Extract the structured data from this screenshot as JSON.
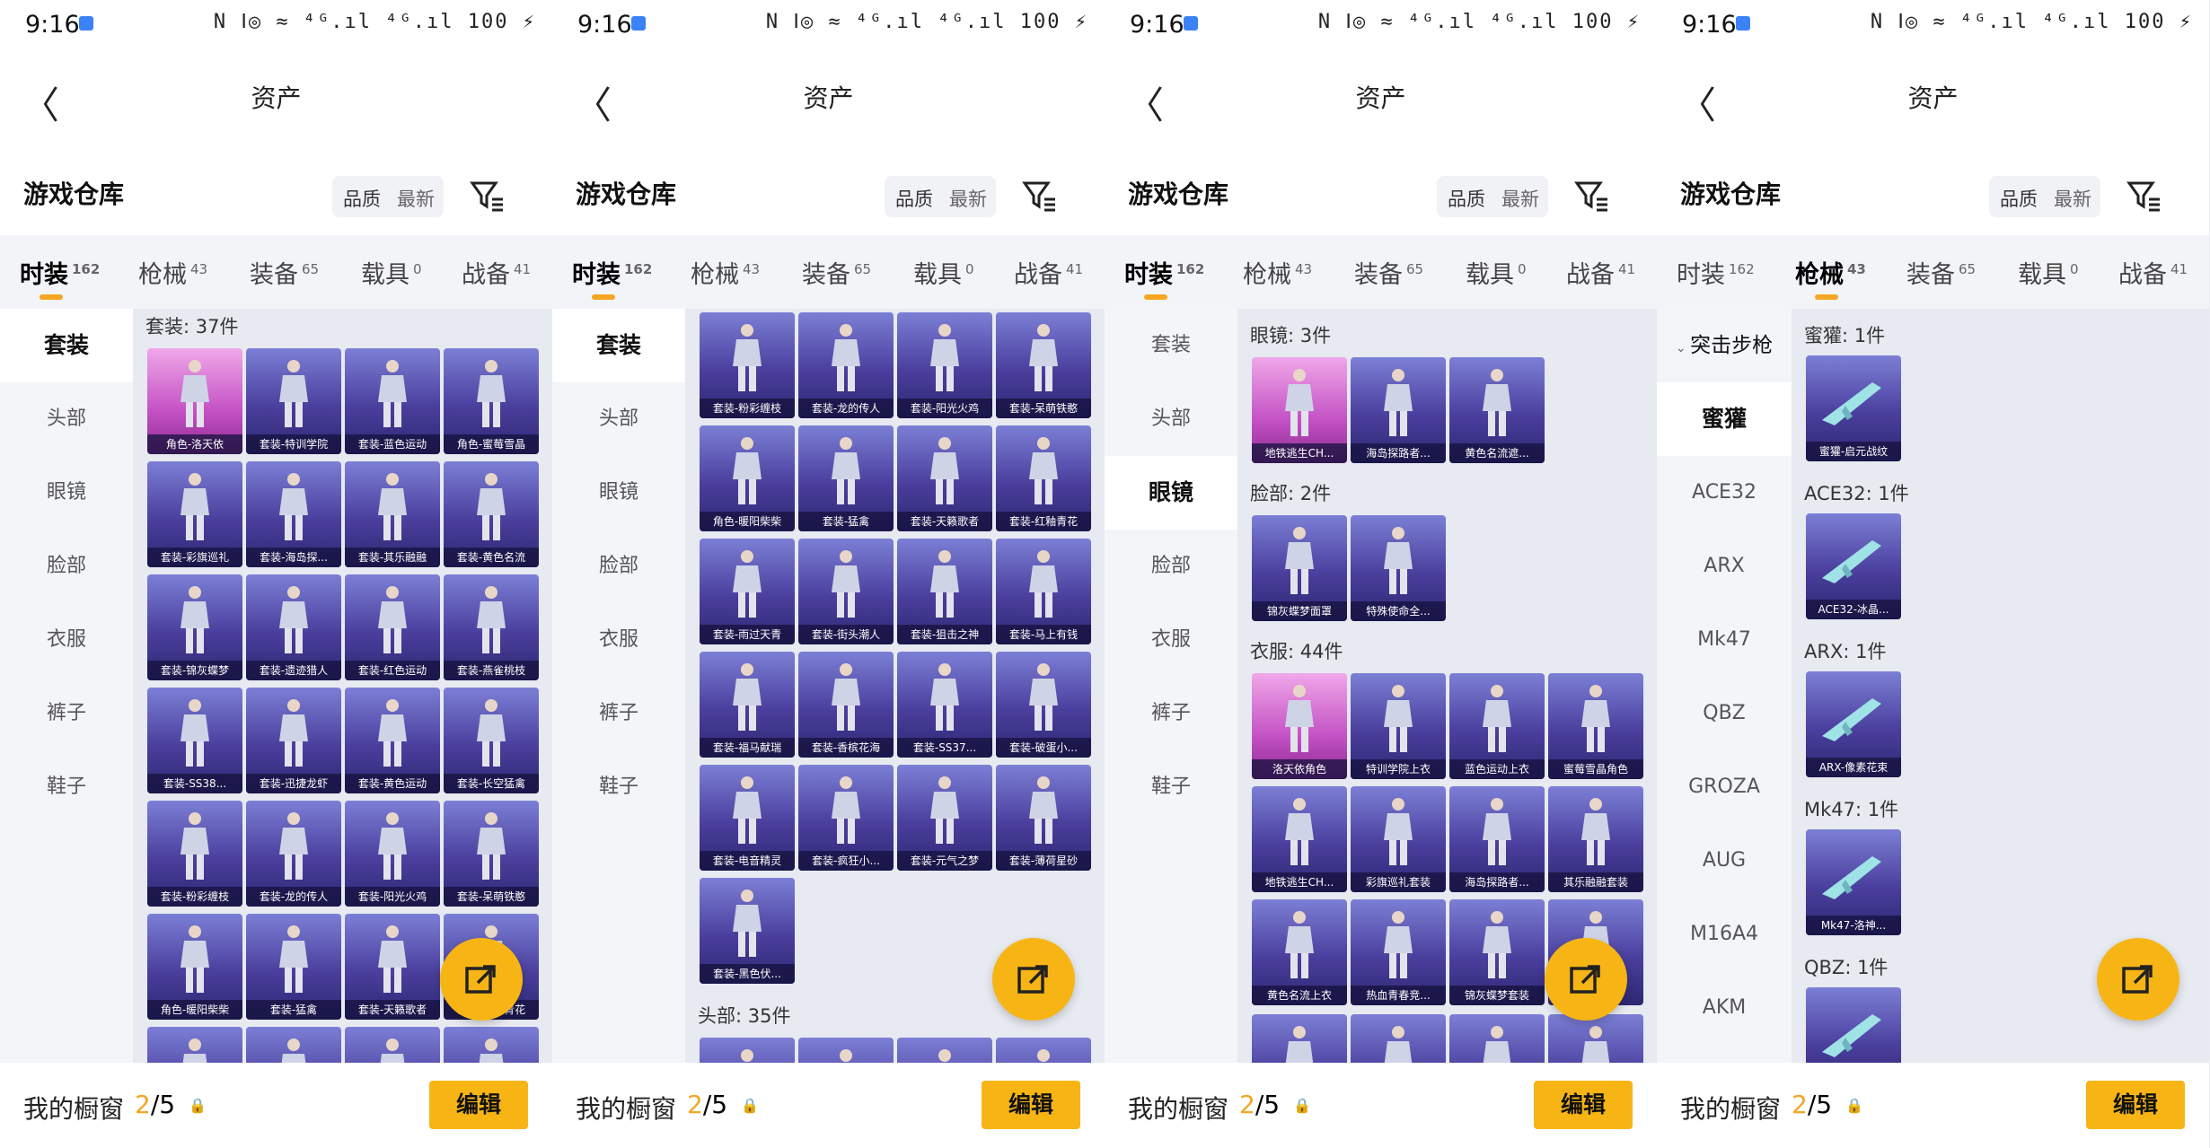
{
  "status": {
    "time": "9:16",
    "icons": "N Ⅰ◎ ≈ ⁴ᴳ.ıl ⁴ᴳ.ıl 100 ⚡"
  },
  "nav": {
    "back": "〈",
    "title": "资产"
  },
  "warehouse": {
    "title": "游戏仓库",
    "sort_quality": "品质",
    "sort_newest": "最新"
  },
  "tabs": [
    {
      "label": "时装",
      "count": "162"
    },
    {
      "label": "枪械",
      "count": "43"
    },
    {
      "label": "装备",
      "count": "65"
    },
    {
      "label": "载具",
      "count": "0"
    },
    {
      "label": "战备",
      "count": "41"
    }
  ],
  "fashion_side": [
    "套装",
    "头部",
    "眼镜",
    "脸部",
    "衣服",
    "裤子",
    "鞋子"
  ],
  "gun_side": [
    "突击步枪",
    "蜜獾",
    "ACE32",
    "ARX",
    "Mk47",
    "QBZ",
    "GROZA",
    "AUG",
    "M16A4",
    "AKM"
  ],
  "bottom": {
    "label": "我的橱窗",
    "count_a": "2",
    "count_b": "/5",
    "edit": "编辑"
  },
  "panel1": {
    "section": "套装: 37件",
    "items": [
      "角色-洛天依",
      "套装-特训学院",
      "套装-蓝色运动",
      "角色-蜜莓雪晶",
      "套装-彩旗巡礼",
      "套装-海岛探...",
      "套装-其乐融融",
      "套装-黄色名流",
      "套装-锦灰蝶梦",
      "套装-遗迹猎人",
      "套装-红色运动",
      "套装-燕雀桃枝",
      "套装-SS38...",
      "套装-迅捷龙虾",
      "套装-黄色运动",
      "套装-长空猛禽",
      "套装-粉彩缠枝",
      "套装-龙的传人",
      "套装-阳光火鸡",
      "套装-呆萌铁憨",
      "角色-暖阳柴柴",
      "套装-猛禽",
      "套装-天籁歌者",
      "套装-红釉青花"
    ]
  },
  "panel2": {
    "items": [
      "套装-粉彩缠枝",
      "套装-龙的传人",
      "套装-阳光火鸡",
      "套装-呆萌铁憨",
      "角色-暖阳柴柴",
      "套装-猛禽",
      "套装-天籁歌者",
      "套装-红釉青花",
      "套装-雨过天青",
      "套装-街头潮人",
      "套装-狙击之神",
      "套装-马上有钱",
      "套装-福马献瑞",
      "套装-香槟花海",
      "套装-SS37...",
      "套装-破蛋小...",
      "套装-电音精灵",
      "套装-疯狂小...",
      "套装-元气之梦",
      "套装-薄荷星砂",
      "套装-黑色伏..."
    ],
    "section_head": "头部: 35件"
  },
  "panel3": {
    "section_glasses": "眼镜: 3件",
    "glasses": [
      "地铁逃生CH...",
      "海岛探路者...",
      "黄色名流遮..."
    ],
    "section_face": "脸部: 2件",
    "face": [
      "锦灰蝶梦面罩",
      "特殊使命全..."
    ],
    "section_clothes": "衣服: 44件",
    "clothes": [
      "洛天依角色",
      "特训学院上衣",
      "蓝色运动上衣",
      "蜜莓雪晶角色",
      "地铁逃生CH...",
      "彩旗巡礼套装",
      "海岛探路者...",
      "其乐融融套装",
      "黄色名流上衣",
      "热血青春竞...",
      "锦灰蝶梦套装",
      ""
    ]
  },
  "panel4": {
    "groups": [
      {
        "title": "蜜獾: 1件",
        "item": "蜜獾-启元战纹"
      },
      {
        "title": "ACE32: 1件",
        "item": "ACE32-冰晶..."
      },
      {
        "title": "ARX: 1件",
        "item": "ARX-像素花束"
      },
      {
        "title": "Mk47: 1件",
        "item": "Mk47-洛神..."
      },
      {
        "title": "QBZ: 1件",
        "item": ""
      }
    ]
  },
  "colors": {
    "accent": "#f7b515",
    "underline": "#f5a623",
    "card": "#4a3f9d",
    "card_pink": "#c351c4"
  }
}
